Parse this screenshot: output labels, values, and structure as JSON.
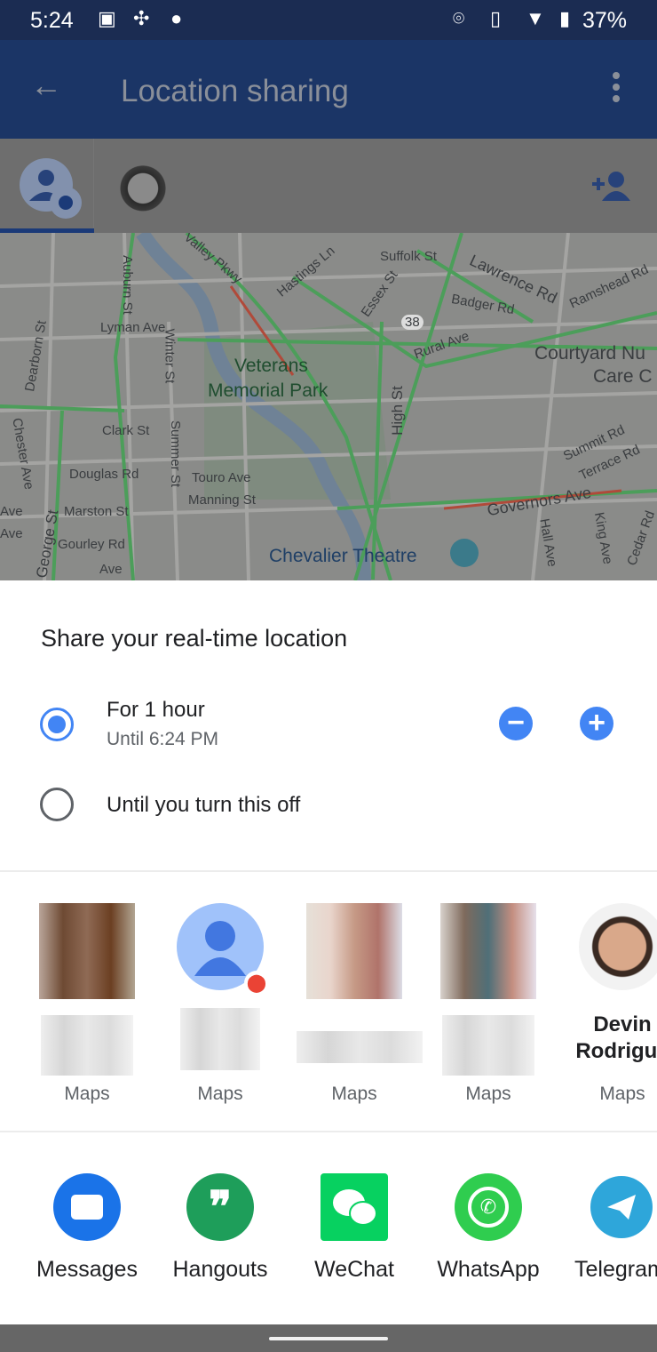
{
  "status_bar": {
    "time": "5:24",
    "battery": "37%",
    "icons": [
      "image-icon",
      "slack-icon",
      "chat-bubble-icon",
      "location-pin-icon",
      "vibrate-icon",
      "wifi-icon",
      "battery-icon"
    ]
  },
  "app_bar": {
    "title": "Location sharing",
    "back_icon": "arrow-left-icon",
    "menu_icon": "more-vert-icon"
  },
  "tabs": {
    "items": [
      "me",
      "contact-photo"
    ],
    "add_person_icon": "person-add-icon"
  },
  "map": {
    "labels": {
      "valley": "Valley Pkwy",
      "auburn": "Auburn St",
      "hastings": "Hastings Ln",
      "suffolk": "Suffolk St",
      "lawrence": "Lawrence Rd",
      "badger": "Badger Rd",
      "ramshead": "Ramshead Rd",
      "essex": "Essex St",
      "route": "38",
      "rural": "Rural Ave",
      "lyman": "Lyman Ave",
      "winter": "Winter St",
      "dearborn": "Dearborn St",
      "park1": "Veterans",
      "park2": "Memorial Park",
      "high": "High St",
      "courtyard1": "Courtyard Nu",
      "courtyard2": "Care C",
      "clark": "Clark St",
      "chester": "Chester Ave",
      "summer": "Summer St",
      "douglas": "Douglas Rd",
      "touro": "Touro Ave",
      "manning": "Manning St",
      "summit": "Summit Rd",
      "terrace": "Terrace Rd",
      "marston": "Marston St",
      "governors": "Governors Ave",
      "gourley": "Gourley Rd",
      "george": "George St",
      "hall": "Hall Ave",
      "king": "King Ave",
      "cedar": "Cedar Rd",
      "chevalier": "Chevalier Theatre",
      "ave1": "Ave",
      "ave2": "Ave",
      "ave3": "Ave"
    }
  },
  "sheet": {
    "title": "Share your real-time location",
    "options": [
      {
        "label": "For 1 hour",
        "sublabel": "Until 6:24 PM",
        "selected": true
      },
      {
        "label": "Until you turn this off",
        "selected": false
      }
    ],
    "decrease": "−",
    "increase": "+",
    "contacts": [
      {
        "name": "",
        "app": "Maps"
      },
      {
        "name": "",
        "app": "Maps"
      },
      {
        "name": "",
        "app": "Maps"
      },
      {
        "name": "",
        "app": "Maps"
      },
      {
        "name": "Devin Rodrigue",
        "app": "Maps"
      }
    ],
    "apps": [
      {
        "label": "Messages",
        "color": "#1a73e8"
      },
      {
        "label": "Hangouts",
        "color": "#1e9e5a"
      },
      {
        "label": "WeChat",
        "color": "#07d160"
      },
      {
        "label": "WhatsApp",
        "color": "#2fcd4f"
      },
      {
        "label": "Telegram",
        "color": "#2ea6da"
      }
    ]
  }
}
